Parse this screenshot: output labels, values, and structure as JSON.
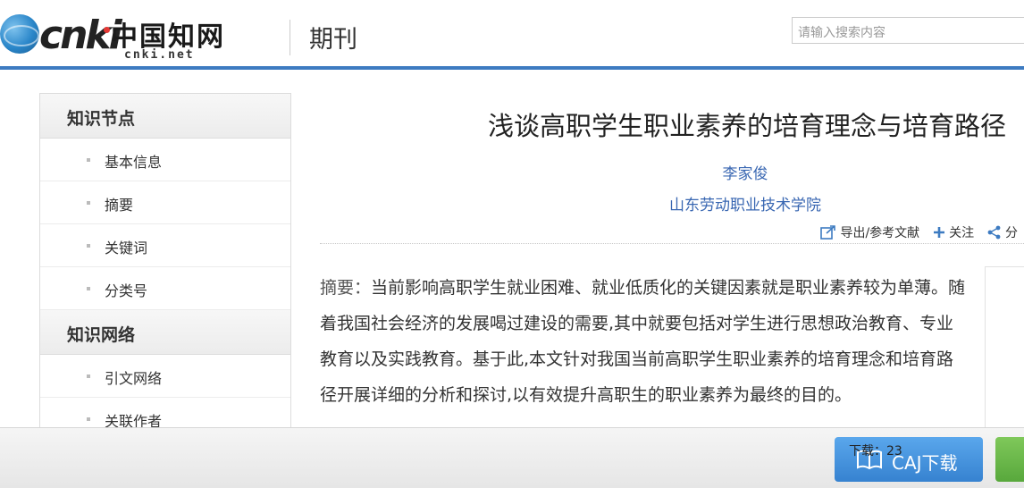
{
  "header": {
    "logo_text": "cnki",
    "logo_cn": "中国知网",
    "logo_domain": "cnki.net",
    "section_title": "期刊",
    "search_placeholder": "请输入搜索内容"
  },
  "sidebar": {
    "groups": [
      {
        "heading": "知识节点",
        "items": [
          "基本信息",
          "摘要",
          "关键词",
          "分类号"
        ]
      },
      {
        "heading": "知识网络",
        "items": [
          "引文网络",
          "关联作者"
        ]
      }
    ]
  },
  "article": {
    "title": "浅谈高职学生职业素养的培育理念与培育路径",
    "author": "李家俊",
    "institution": "山东劳动职业技术学院",
    "abstract_label": "摘要：",
    "abstract_text": "当前影响高职学生就业困难、就业低质化的关键因素就是职业素养较为单薄。随着我国社会经济的发展喝过建设的需要,其中就要包括对学生进行思想政治教育、专业教育以及实践教育。基于此,本文针对我国当前高职学生职业素养的培育理念和培育路径开展详细的分析和探讨,以有效提升高职生的职业素养为最终的目的。"
  },
  "actions": {
    "export_label": "导出/参考文献",
    "follow_label": "关注",
    "share_label": "分"
  },
  "bottom": {
    "download_count_label": "下载：23",
    "caj_button_label": "CAJ下载"
  },
  "colors": {
    "accent": "#3d7bc1",
    "link": "#3967b2",
    "caj_button": "#4a95e0"
  }
}
